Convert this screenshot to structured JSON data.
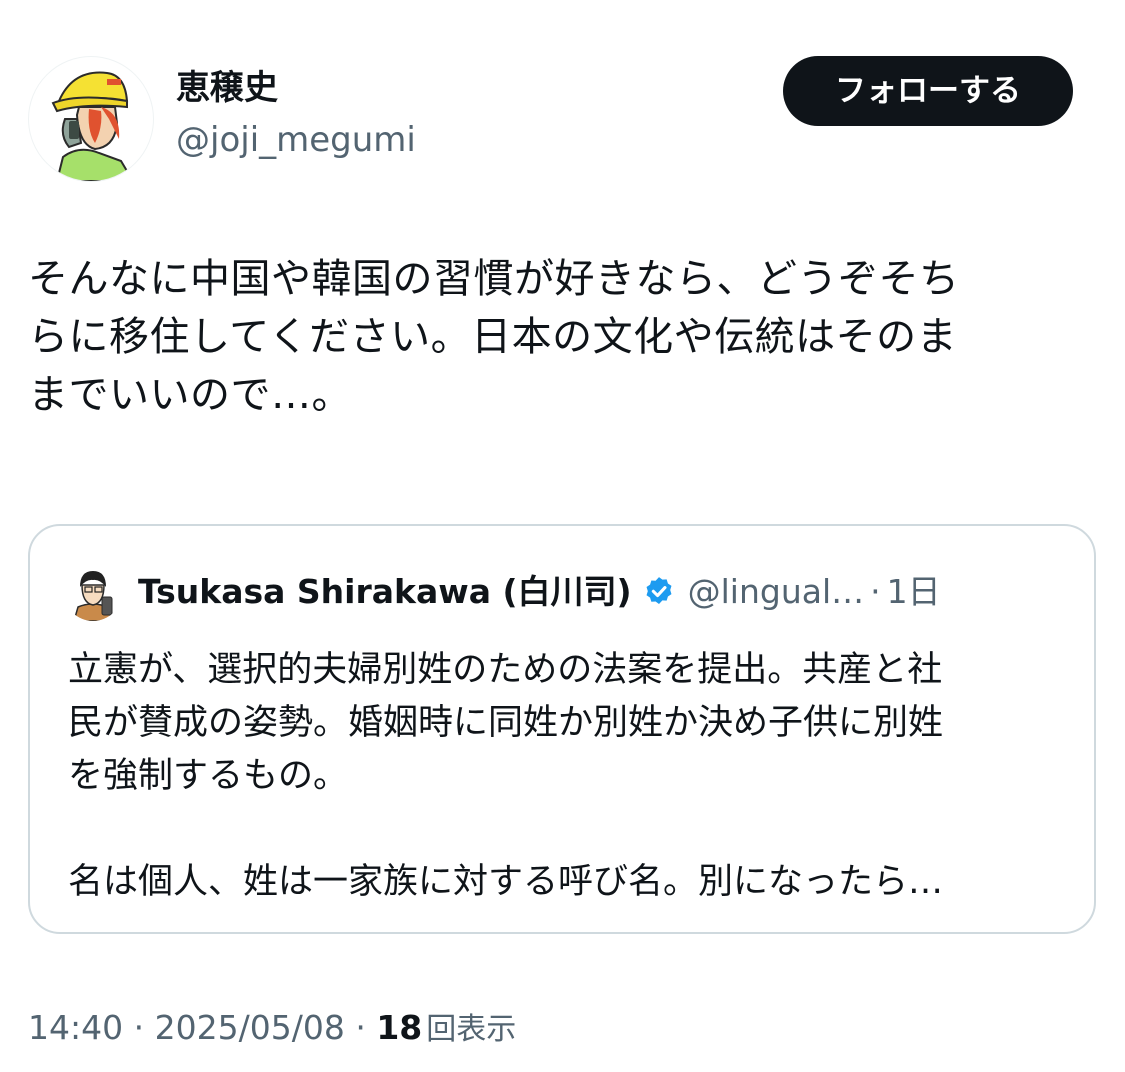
{
  "tweet": {
    "author": {
      "display_name": "恵穣史",
      "handle": "@joji_megumi",
      "avatar_icon": "cartoon-avatar-icon"
    },
    "follow_button_label": "フォローする",
    "text_lines": [
      "そんなに中国や韓国の習慣が好きなら、どうぞそち",
      "らに移住してください。日本の文化や伝統はそのま",
      "までいいので…。"
    ],
    "quote": {
      "author_name": "Tsukasa Shirakawa (白川司)",
      "verified_icon": "verified-badge-icon",
      "handle": "@lingual…",
      "separator": "·",
      "time": "1日",
      "text_lines": [
        "立憲が、選択的夫婦別姓のための法案を提出。共産と社",
        "民が賛成の姿勢。婚姻時に同姓か別姓か決め子供に別姓",
        "を強制するもの。",
        "",
        "名は個人、姓は一家族に対する呼び名。別になったら…"
      ]
    },
    "meta": {
      "time": "14:40",
      "separator": "·",
      "date": "2025/05/08",
      "views_count": "18",
      "views_label": "回表示"
    }
  },
  "colors": {
    "primary_text": "#0f1419",
    "secondary_text": "#536471",
    "border": "#cfd9de",
    "verified_blue": "#1d9bf0",
    "button_bg": "#0f1419"
  }
}
